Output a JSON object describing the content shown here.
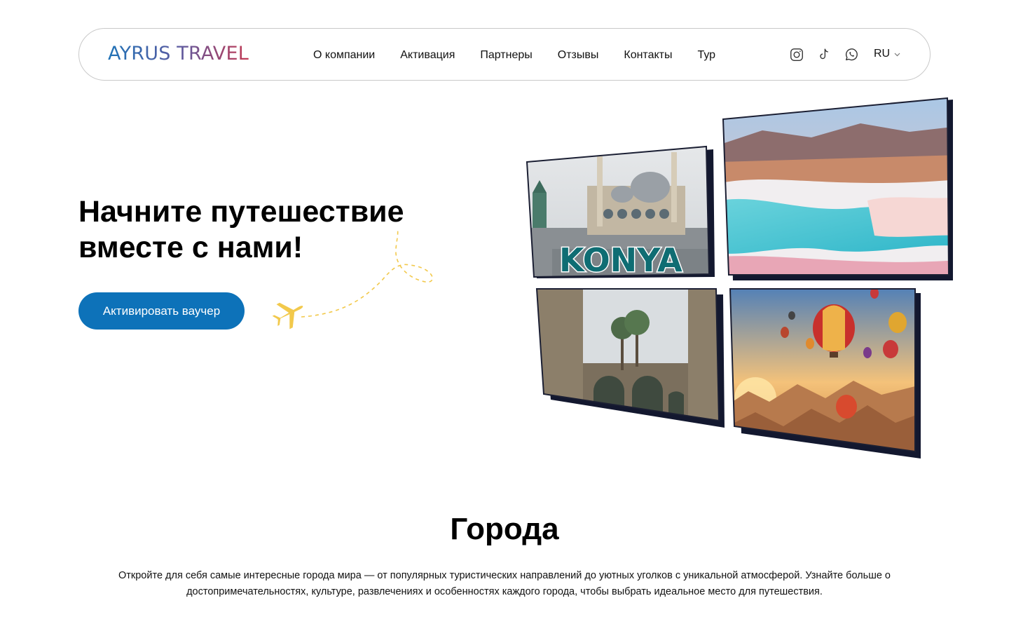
{
  "header": {
    "logo": "AYRUS TRAVEL",
    "nav": [
      {
        "label": "О компании"
      },
      {
        "label": "Активация"
      },
      {
        "label": "Партнеры"
      },
      {
        "label": "Отзывы"
      },
      {
        "label": "Контакты"
      },
      {
        "label": "Тур"
      }
    ],
    "social_icons": [
      "instagram-icon",
      "tiktok-icon",
      "whatsapp-icon"
    ],
    "language": "RU"
  },
  "hero": {
    "title_line1": "Начните путешествие",
    "title_line2": "вместе с нами!",
    "cta_label": "Активировать ваучер",
    "konya_label": "KONYA"
  },
  "cities": {
    "title": "Города",
    "description": "Откройте для себя самые интересные города мира — от популярных туристических направлений до уютных уголков с уникальной атмосферой. Узнайте больше о достопримечательностях, культуре, развлечениях и особенностях каждого города, чтобы выбрать идеальное место для путешествия."
  },
  "colors": {
    "accent": "#0d72b9",
    "plane": "#f2c94c",
    "frame": "#13182f"
  }
}
